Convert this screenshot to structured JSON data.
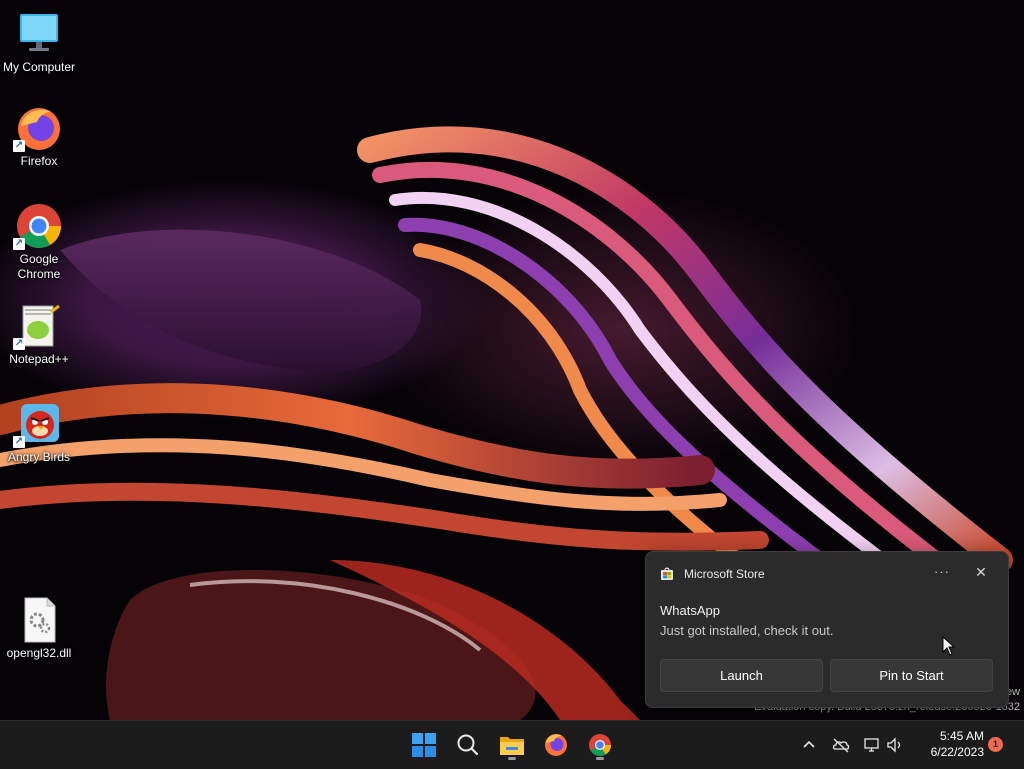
{
  "desktop": {
    "icons": [
      {
        "label": "My Computer",
        "icon": "monitor-icon"
      },
      {
        "label": "Firefox",
        "icon": "firefox-icon"
      },
      {
        "label": "Google Chrome",
        "icon": "chrome-icon"
      },
      {
        "label": "Notepad++",
        "icon": "notepadpp-icon"
      },
      {
        "label": "Angry Birds",
        "icon": "angry-birds-icon"
      },
      {
        "label": "opengl32.dll",
        "icon": "dll-file-icon"
      }
    ]
  },
  "toast": {
    "app_name": "Microsoft Store",
    "more_label": "···",
    "close_label": "✕",
    "title": "WhatsApp",
    "body": "Just got installed, check it out.",
    "buttons": {
      "launch": "Launch",
      "pin": "Pin to Start"
    }
  },
  "watermark": {
    "line1": "ew",
    "line2": "Evaluation copy. Build 25375.zn_release.230520-1632"
  },
  "taskbar": {
    "apps": [
      "start-icon",
      "search-icon",
      "file-explorer-icon",
      "firefox-icon",
      "chrome-icon"
    ],
    "tray": [
      "chevron-up-icon",
      "onedrive-icon",
      "network-icon",
      "volume-icon"
    ],
    "time": "5:45 AM",
    "date": "6/22/2023",
    "notification_count": "1"
  },
  "colors": {
    "taskbar": "#1c1c1c",
    "toast_bg": "#2b2b2b",
    "badge": "#f06a4d"
  }
}
